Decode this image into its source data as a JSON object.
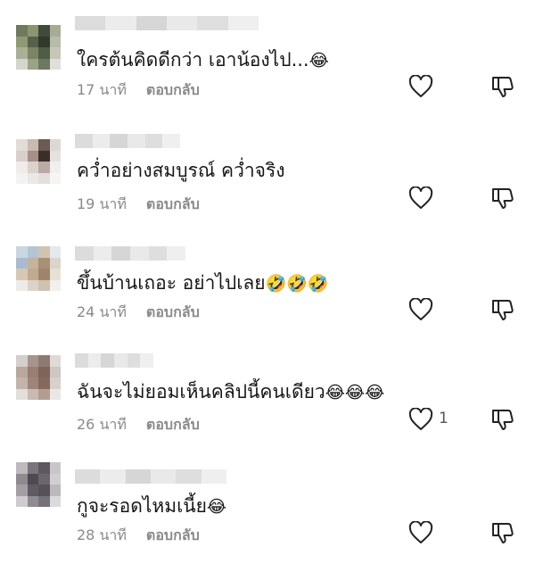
{
  "comments": [
    {
      "text": "ใครต้นคิดดีกว่า เอาน้องไป...",
      "emoji": "😂",
      "time": "17 นาที",
      "reply": "ตอบกลับ",
      "likes": "",
      "avatar_colors": [
        "#6f7a5c",
        "#8c9470",
        "#3f4a3a",
        "#a6ad95",
        "#8f9a72",
        "#55614b",
        "#2f3a2d",
        "#b7bca8",
        "#a8b095",
        "#7b8566",
        "#505c46",
        "#c5c8b8",
        "#d4d6cc",
        "#9aa287",
        "#6e7860",
        "#dfe1d8"
      ]
    },
    {
      "text": "คว่ำอย่างสมบูรณ์ คว่ำจริง",
      "emoji": "",
      "time": "19 นาที",
      "reply": "ตอบกลับ",
      "likes": "",
      "avatar_colors": [
        "#e2dcd8",
        "#c9b9b0",
        "#6b5a52",
        "#ded8d4",
        "#d8cfca",
        "#a68f86",
        "#3a2e2a",
        "#e6e2df",
        "#efecea",
        "#d9d2cd",
        "#b9aaa3",
        "#f1efed",
        "#f4f3f2",
        "#ebe8e6",
        "#e3dfdc",
        "#f6f5f4"
      ]
    },
    {
      "text": "ขึ้นบ้านเถอะ อย่าไปเลย",
      "emoji": "🤣🤣🤣",
      "time": "24 นาที",
      "reply": "ตอบกลับ",
      "likes": "",
      "avatar_colors": [
        "#c9d6e2",
        "#b3c4d3",
        "#d1c3b2",
        "#e4e9ee",
        "#a9bccf",
        "#c7b39c",
        "#a88f77",
        "#dcd4ca",
        "#d7c7b5",
        "#c2aa90",
        "#9f856b",
        "#e8e0d6",
        "#ecebe8",
        "#dcd3c8",
        "#d0c2b1",
        "#f2f0ed"
      ]
    },
    {
      "text": "ฉันจะไม่ยอมเห็นคลิปนี้คนเดียว",
      "emoji": "😂😂😂",
      "time": "26 นาที",
      "reply": "ตอบกลับ",
      "likes": "1",
      "avatar_colors": [
        "#d3cfcc",
        "#a7958d",
        "#8f7a70",
        "#dedad7",
        "#b9a69d",
        "#9a7e72",
        "#7d655b",
        "#cfc6c1",
        "#c4b3aa",
        "#9f8479",
        "#86695d",
        "#d8d0cb",
        "#e3deda",
        "#c9bab2",
        "#b39d93",
        "#ebe7e4"
      ]
    },
    {
      "text": "กูจะรอดไหมเนี้ย",
      "emoji": "😂",
      "time": "28 นาที",
      "reply": "ตอบกลับ",
      "likes": "",
      "avatar_colors": [
        "#bdb9bc",
        "#7a757c",
        "#5c5760",
        "#c9c6c9",
        "#8e8a90",
        "#4f4a52",
        "#6b666d",
        "#d2cfd2",
        "#a29ea3",
        "#605b63",
        "#55505a",
        "#bcb8bd",
        "#cfccd0",
        "#8f8b91",
        "#77727a",
        "#dcdadc"
      ]
    }
  ],
  "icons": {
    "like": "heart-outline-icon",
    "dislike": "thumbs-down-outline-icon"
  }
}
